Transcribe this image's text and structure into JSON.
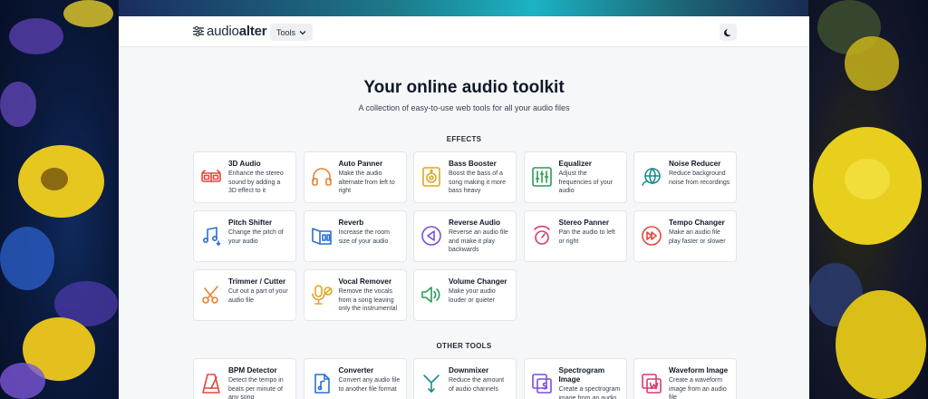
{
  "nav": {
    "logo_left": "audio",
    "logo_right": "alter",
    "tools_label": "Tools"
  },
  "hero": {
    "title": "Your online audio toolkit",
    "subtitle": "A collection of easy-to-use web tools for all your audio files"
  },
  "sections": {
    "effects": "EFFECTS",
    "other": "OTHER TOOLS"
  },
  "effects": [
    {
      "title": "3D Audio",
      "desc": "Enhance the stereo sound by adding a 3D effect to it",
      "icon": "3d-glasses-icon",
      "color": "#e0483e"
    },
    {
      "title": "Auto Panner",
      "desc": "Make the audio alternate from left to right",
      "icon": "headphones-icon",
      "color": "#e8822e"
    },
    {
      "title": "Bass Booster",
      "desc": "Boost the bass of a song making it more bass heavy",
      "icon": "speaker-icon",
      "color": "#e0a61e"
    },
    {
      "title": "Equalizer",
      "desc": "Adjust the frequencies of your audio",
      "icon": "equalizer-icon",
      "color": "#2e9a57"
    },
    {
      "title": "Noise Reducer",
      "desc": "Reduce background noise from recordings",
      "icon": "globe-icon",
      "color": "#1f8a8a"
    },
    {
      "title": "Pitch Shifter",
      "desc": "Change the pitch of your audio",
      "icon": "music-note-icon",
      "color": "#2c6fd6"
    },
    {
      "title": "Reverb",
      "desc": "Increase the room size of your audio",
      "icon": "room-icon",
      "color": "#2c6fd6"
    },
    {
      "title": "Reverse Audio",
      "desc": "Reverse an audio file and make it play backwards",
      "icon": "reverse-play-icon",
      "color": "#7c4ddb"
    },
    {
      "title": "Stereo Panner",
      "desc": "Pan the audio to left or right",
      "icon": "dial-icon",
      "color": "#d63b6e"
    },
    {
      "title": "Tempo Changer",
      "desc": "Make an audio file play faster or slower",
      "icon": "fast-forward-icon",
      "color": "#e0483e"
    },
    {
      "title": "Trimmer / Cutter",
      "desc": "Cut out a part of your audio file",
      "icon": "scissors-icon",
      "color": "#e8822e"
    },
    {
      "title": "Vocal Remover",
      "desc": "Remove the vocals from a song leaving only the instrumental",
      "icon": "microphone-off-icon",
      "color": "#e0a61e"
    },
    {
      "title": "Volume Changer",
      "desc": "Make your audio louder or quieter",
      "icon": "volume-icon",
      "color": "#2e9a57"
    }
  ],
  "other_tools": [
    {
      "title": "BPM Detector",
      "desc": "Detect the tempo in beats per minute of any song",
      "icon": "metronome-icon",
      "color": "#e0483e"
    },
    {
      "title": "Converter",
      "desc": "Convert any audio file to another file format",
      "icon": "audio-file-icon",
      "color": "#2c6fd6"
    },
    {
      "title": "Downmixer",
      "desc": "Reduce the amount of audio channels",
      "icon": "downmix-icon",
      "color": "#1f8a8a"
    },
    {
      "title": "Spectrogram Image",
      "desc": "Create a spectrogram image from an audio",
      "icon": "spectrogram-icon",
      "color": "#7c4ddb"
    },
    {
      "title": "Waveform Image",
      "desc": "Create a waveform image from an audio file",
      "icon": "waveform-image-icon",
      "color": "#d63b6e"
    }
  ]
}
